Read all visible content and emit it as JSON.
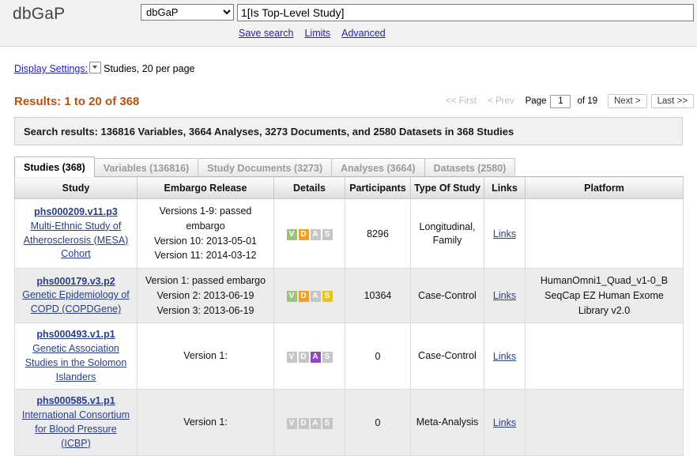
{
  "header": {
    "brand": "dbGaP",
    "database_selected": "dbGaP",
    "database_options": [
      "dbGaP"
    ],
    "search_value": "1[Is Top-Level Study]",
    "links": [
      {
        "label": "Save search",
        "name": "save-search-link"
      },
      {
        "label": "Limits",
        "name": "limits-link"
      },
      {
        "label": "Advanced",
        "name": "advanced-link"
      }
    ]
  },
  "display_settings": {
    "label": "Display Settings:",
    "summary": "Studies, 20 per page"
  },
  "results": {
    "summary": "Results: 1 to 20 of 368",
    "banner": "Search results: 136816 Variables, 3664 Analyses, 3273 Documents, and 2580 Datasets in 368 Studies"
  },
  "pager": {
    "first": "<< First",
    "prev": "< Prev",
    "page_label": "Page",
    "page_value": "1",
    "of_label": "of 19",
    "next": "Next >",
    "last": "Last >>"
  },
  "tabs": [
    {
      "label": "Studies (368)",
      "name": "tab-studies",
      "active": true
    },
    {
      "label": "Variables (136816)",
      "name": "tab-variables",
      "active": false
    },
    {
      "label": "Study Documents (3273)",
      "name": "tab-study-documents",
      "active": false
    },
    {
      "label": "Analyses (3664)",
      "name": "tab-analyses",
      "active": false
    },
    {
      "label": "Datasets (2580)",
      "name": "tab-datasets",
      "active": false
    }
  ],
  "table": {
    "columns": [
      "Study",
      "Embargo Release",
      "Details",
      "Participants",
      "Type Of Study",
      "Links",
      "Platform"
    ],
    "links_label": "Links",
    "badge_colors": {
      "green": "#9ac37e",
      "orange": "#f3a021",
      "gold": "#e8c51d",
      "purple": "#8b49c2",
      "gray": "#c6c6c6"
    },
    "rows": [
      {
        "accession": "phs000209.v11.p3",
        "title": "Multi-Ethnic Study of Atherosclerosis (MESA) Cohort",
        "embargo": "Versions 1-9: passed embargo\nVersion 10: 2013-05-01\nVersion 11: 2014-03-12",
        "details": [
          {
            "letter": "V",
            "color": "green"
          },
          {
            "letter": "D",
            "color": "orange"
          },
          {
            "letter": "A",
            "color": "gray"
          },
          {
            "letter": "S",
            "color": "gray"
          }
        ],
        "participants": "8296",
        "type": "Longitudinal, Family",
        "platform": ""
      },
      {
        "accession": "phs000179.v3.p2",
        "title": "Genetic Epidemiology of COPD (COPDGene)",
        "embargo": "Version 1: passed embargo\nVersion 2: 2013-06-19\nVersion 3: 2013-06-19",
        "details": [
          {
            "letter": "V",
            "color": "green"
          },
          {
            "letter": "D",
            "color": "orange"
          },
          {
            "letter": "A",
            "color": "gray"
          },
          {
            "letter": "S",
            "color": "gold"
          }
        ],
        "participants": "10364",
        "type": "Case-Control",
        "platform": "HumanOmni1_Quad_v1-0_B\nSeqCap EZ Human Exome Library v2.0"
      },
      {
        "accession": "phs000493.v1.p1",
        "title": "Genetic Association Studies in the Solomon Islanders",
        "embargo": "Version 1:",
        "details": [
          {
            "letter": "V",
            "color": "gray"
          },
          {
            "letter": "D",
            "color": "gray"
          },
          {
            "letter": "A",
            "color": "purple"
          },
          {
            "letter": "S",
            "color": "gray"
          }
        ],
        "participants": "0",
        "type": "Case-Control",
        "platform": ""
      },
      {
        "accession": "phs000585.v1.p1",
        "title": "International Consortium for Blood Pressure (ICBP)",
        "embargo": "Version 1:",
        "details": [
          {
            "letter": "V",
            "color": "gray"
          },
          {
            "letter": "D",
            "color": "gray"
          },
          {
            "letter": "A",
            "color": "gray"
          },
          {
            "letter": "S",
            "color": "gray"
          }
        ],
        "participants": "0",
        "type": "Meta-Analysis",
        "platform": ""
      }
    ]
  }
}
